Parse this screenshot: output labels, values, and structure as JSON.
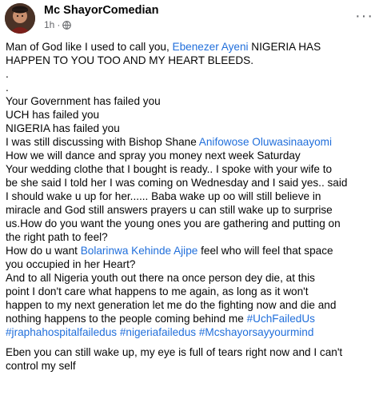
{
  "post": {
    "author": "Mc ShayorComedian",
    "time": "1h",
    "separator": "·",
    "more_label": "···",
    "icons": {
      "avatar": "profile-photo",
      "privacy": "globe-icon",
      "more": "more-options-icon"
    },
    "colors": {
      "link": "#216fdb",
      "meta": "#65676b",
      "text": "#050505"
    },
    "paragraph1": [
      {
        "segments": [
          {
            "text": "Man of God like I used to call you, "
          },
          {
            "text": "Ebenezer Ayeni",
            "link": true
          },
          {
            "text": " NIGERIA HAS"
          }
        ]
      },
      {
        "segments": [
          {
            "text": "HAPPEN TO YOU TOO AND MY HEART BLEEDS."
          }
        ]
      },
      {
        "segments": [
          {
            "text": "."
          }
        ]
      },
      {
        "segments": [
          {
            "text": "."
          }
        ]
      },
      {
        "segments": [
          {
            "text": "Your Government has failed you"
          }
        ]
      },
      {
        "segments": [
          {
            "text": "UCH has failed you"
          }
        ]
      },
      {
        "segments": [
          {
            "text": "NIGERIA has failed you"
          }
        ]
      },
      {
        "segments": [
          {
            "text": "I was still discussing with Bishop Shane "
          },
          {
            "text": "Anifowose Oluwasinaayomi",
            "link": true
          }
        ]
      },
      {
        "segments": [
          {
            "text": "How we will dance and spray you money next week Saturday"
          }
        ]
      },
      {
        "segments": [
          {
            "text": "Your wedding clothe that I bought is ready.. I spoke with your wife to"
          }
        ]
      },
      {
        "segments": [
          {
            "text": "be she said I told her I was coming on Wednesday and I said yes.. said"
          }
        ]
      },
      {
        "segments": [
          {
            "text": "I should wake u up for her...... Baba wake up oo will still believe in"
          }
        ]
      },
      {
        "segments": [
          {
            "text": "miracle and God still answers prayers u can still wake up to surprise"
          }
        ]
      },
      {
        "segments": [
          {
            "text": "us.How do you want the young ones you are gathering and putting on"
          }
        ]
      },
      {
        "segments": [
          {
            "text": "the right path to feel?"
          }
        ]
      },
      {
        "segments": [
          {
            "text": "How do u want "
          },
          {
            "text": "Bolarinwa Kehinde Ajipe",
            "link": true
          },
          {
            "text": " feel who will feel that space"
          }
        ]
      },
      {
        "segments": [
          {
            "text": "you occupied in her Heart?"
          }
        ]
      },
      {
        "segments": [
          {
            "text": "And to all Nigeria youth out there na once person dey die, at this"
          }
        ]
      },
      {
        "segments": [
          {
            "text": "point I don't care what happens to me again, as long as it won't"
          }
        ]
      },
      {
        "segments": [
          {
            "text": "happen to my next generation let me do the fighting now and die and"
          }
        ]
      },
      {
        "segments": [
          {
            "text": "nothing happens to the people coming behind me "
          },
          {
            "text": "#UchFailedUs",
            "link": true
          }
        ]
      },
      {
        "segments": [
          {
            "text": "#jraphahospitalfailedus",
            "link": true
          },
          {
            "text": " "
          },
          {
            "text": "#nigeriafailedus",
            "link": true
          },
          {
            "text": " "
          },
          {
            "text": "#Mcshayorsayyourmind",
            "link": true
          }
        ]
      }
    ],
    "paragraph2": [
      {
        "segments": [
          {
            "text": "Eben you can still wake up, my eye is full of tears right now and I can't"
          }
        ]
      },
      {
        "segments": [
          {
            "text": "control my self"
          }
        ]
      }
    ]
  }
}
